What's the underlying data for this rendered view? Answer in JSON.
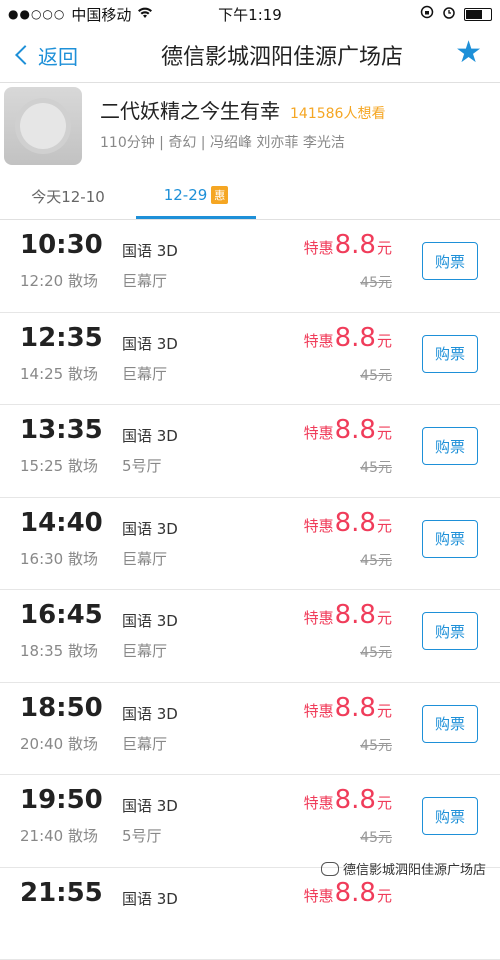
{
  "status_bar": {
    "signal": "●●○○○",
    "carrier": "中国移动",
    "time": "下午1:19"
  },
  "nav": {
    "back_label": "返回",
    "title": "德信影城泗阳佳源广场店"
  },
  "movie": {
    "title": "二代妖精之今生有幸",
    "want_count": "141586人想看",
    "meta": "110分钟 | 奇幻 | 冯绍峰 刘亦菲 李光洁"
  },
  "tabs": [
    {
      "label": "今天12-10"
    },
    {
      "label": "12-29",
      "badge": "惠"
    }
  ],
  "showtimes": [
    {
      "start": "10:30",
      "end": "12:20 散场",
      "lang": "国语 3D",
      "hall": "巨幕厅",
      "prefix": "特惠",
      "price": "8.8",
      "unit": "元",
      "orig": "45元",
      "buy": "购票"
    },
    {
      "start": "12:35",
      "end": "14:25 散场",
      "lang": "国语 3D",
      "hall": "巨幕厅",
      "prefix": "特惠",
      "price": "8.8",
      "unit": "元",
      "orig": "45元",
      "buy": "购票"
    },
    {
      "start": "13:35",
      "end": "15:25 散场",
      "lang": "国语 3D",
      "hall": "5号厅",
      "prefix": "特惠",
      "price": "8.8",
      "unit": "元",
      "orig": "45元",
      "buy": "购票"
    },
    {
      "start": "14:40",
      "end": "16:30 散场",
      "lang": "国语 3D",
      "hall": "巨幕厅",
      "prefix": "特惠",
      "price": "8.8",
      "unit": "元",
      "orig": "45元",
      "buy": "购票"
    },
    {
      "start": "16:45",
      "end": "18:35 散场",
      "lang": "国语 3D",
      "hall": "巨幕厅",
      "prefix": "特惠",
      "price": "8.8",
      "unit": "元",
      "orig": "45元",
      "buy": "购票"
    },
    {
      "start": "18:50",
      "end": "20:40 散场",
      "lang": "国语 3D",
      "hall": "巨幕厅",
      "prefix": "特惠",
      "price": "8.8",
      "unit": "元",
      "orig": "45元",
      "buy": "购票"
    },
    {
      "start": "19:50",
      "end": "21:40 散场",
      "lang": "国语 3D",
      "hall": "5号厅",
      "prefix": "特惠",
      "price": "8.8",
      "unit": "元",
      "orig": "45元",
      "buy": "购票"
    },
    {
      "start": "21:55",
      "end": "",
      "lang": "国语 3D",
      "hall": "",
      "prefix": "特惠",
      "price": "8.8",
      "unit": "元",
      "orig": "",
      "buy": ""
    }
  ],
  "watermark": "德信影城泗阳佳源广场店",
  "colors": {
    "accent": "#1e90d8",
    "price": "#f03c5a",
    "badge": "#f5a623"
  }
}
